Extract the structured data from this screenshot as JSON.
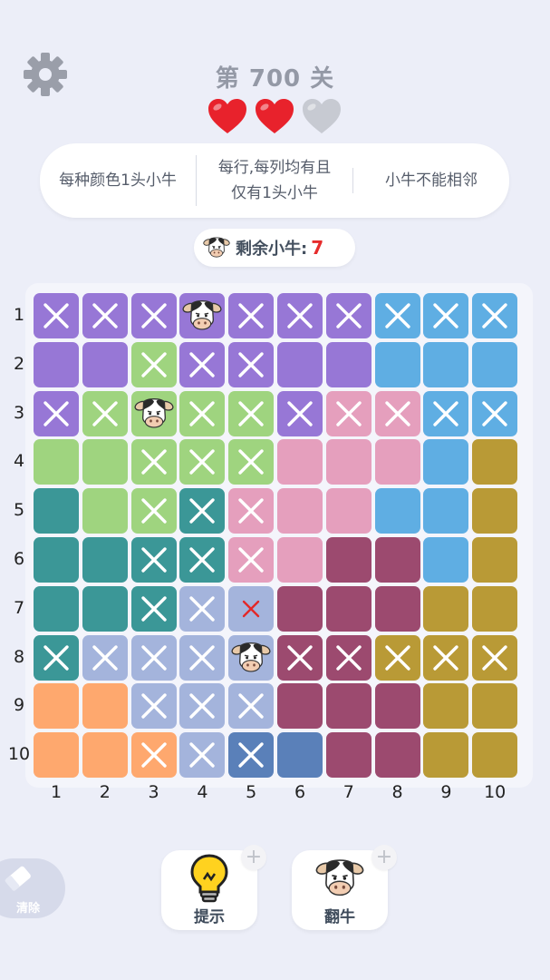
{
  "header": {
    "level_title": "第 700 关",
    "lives_total": 3,
    "lives_remaining": 2
  },
  "rules": [
    "每种颜色1头小牛",
    "每行,每列均有且仅有1头小牛",
    "小牛不能相邻"
  ],
  "remaining": {
    "label": "剩余小牛:",
    "count": "7"
  },
  "board": {
    "row_labels": [
      "1",
      "2",
      "3",
      "4",
      "5",
      "6",
      "7",
      "8",
      "9",
      "10"
    ],
    "col_labels": [
      "1",
      "2",
      "3",
      "4",
      "5",
      "6",
      "7",
      "8",
      "9",
      "10"
    ],
    "palette": {
      "P": "#9777d6",
      "B": "#5faee3",
      "G": "#9fd47f",
      "K": "#e59fbd",
      "Y": "#b99a36",
      "T": "#3b9797",
      "M": "#9c4a6f",
      "L": "#a4b4dc",
      "O": "#fea86e",
      "N": "#5a80b9"
    },
    "colors": [
      [
        "P",
        "P",
        "P",
        "P",
        "P",
        "P",
        "P",
        "B",
        "B",
        "B"
      ],
      [
        "P",
        "P",
        "G",
        "P",
        "P",
        "P",
        "P",
        "B",
        "B",
        "B"
      ],
      [
        "P",
        "G",
        "G",
        "G",
        "G",
        "P",
        "K",
        "K",
        "B",
        "B"
      ],
      [
        "G",
        "G",
        "G",
        "G",
        "G",
        "K",
        "K",
        "K",
        "B",
        "Y"
      ],
      [
        "T",
        "G",
        "G",
        "T",
        "K",
        "K",
        "K",
        "B",
        "B",
        "Y"
      ],
      [
        "T",
        "T",
        "T",
        "T",
        "K",
        "K",
        "M",
        "M",
        "B",
        "Y"
      ],
      [
        "T",
        "T",
        "T",
        "L",
        "L",
        "M",
        "M",
        "M",
        "Y",
        "Y"
      ],
      [
        "T",
        "L",
        "L",
        "L",
        "L",
        "M",
        "M",
        "Y",
        "Y",
        "Y"
      ],
      [
        "O",
        "O",
        "L",
        "L",
        "L",
        "M",
        "M",
        "M",
        "Y",
        "Y"
      ],
      [
        "O",
        "O",
        "O",
        "L",
        "N",
        "N",
        "M",
        "M",
        "Y",
        "Y"
      ]
    ],
    "marks": [
      [
        "x",
        "x",
        "x",
        "c",
        "x",
        "x",
        "x",
        "x",
        "x",
        "x"
      ],
      [
        "",
        "",
        "x",
        "x",
        "x",
        "",
        "",
        "",
        "",
        ""
      ],
      [
        "x",
        "x",
        "c",
        "x",
        "x",
        "x",
        "x",
        "x",
        "x",
        "x"
      ],
      [
        "",
        "",
        "x",
        "x",
        "x",
        "",
        "",
        "",
        "",
        ""
      ],
      [
        "",
        "",
        "x",
        "x",
        "x",
        "",
        "",
        "",
        "",
        ""
      ],
      [
        "",
        "",
        "x",
        "x",
        "x",
        "",
        "",
        "",
        "",
        ""
      ],
      [
        "",
        "",
        "x",
        "x",
        "r",
        "",
        "",
        "",
        "",
        ""
      ],
      [
        "x",
        "x",
        "x",
        "x",
        "c",
        "x",
        "x",
        "x",
        "x",
        "x"
      ],
      [
        "",
        "",
        "x",
        "x",
        "x",
        "",
        "",
        "",
        "",
        ""
      ],
      [
        "",
        "",
        "x",
        "x",
        "x",
        "",
        "",
        "",
        "",
        ""
      ]
    ]
  },
  "tools": {
    "hint_label": "提示",
    "flip_label": "翻牛",
    "clear_label": "清除",
    "plus": "+"
  }
}
